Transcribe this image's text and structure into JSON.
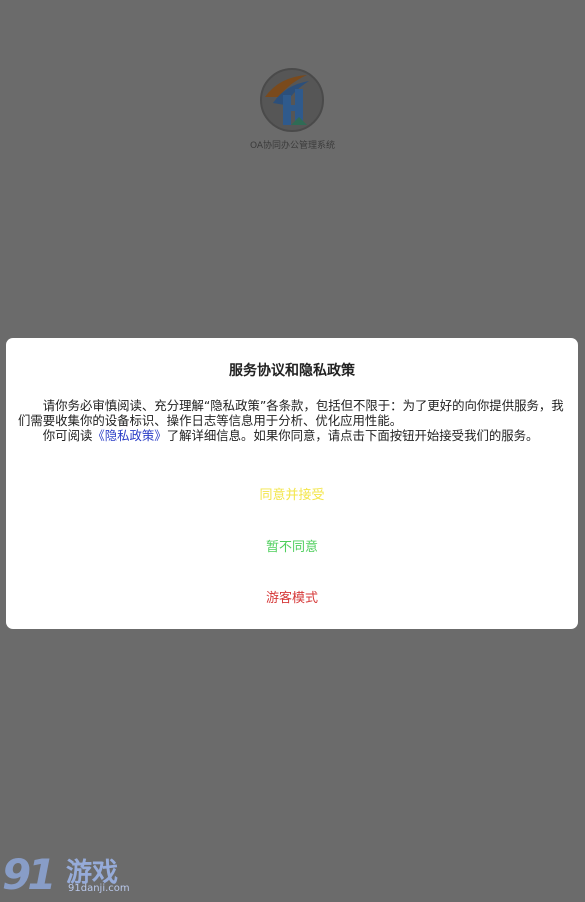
{
  "splash": {
    "caption": "OA协同办公管理系统",
    "logo_icon": "oa-logo-icon"
  },
  "dialog": {
    "title": "服务协议和隐私政策",
    "paragraph1": "请你务必审慎阅读、充分理解“隐私政策”各条款，包括但不限于：为了更好的向你提供服务，我们需要收集你的设备标识、操作日志等信息用于分析、优化应用性能。",
    "paragraph2_prefix": "你可阅读",
    "policy_link": "《隐私政策》",
    "paragraph2_suffix": "了解详细信息。如果你同意，请点击下面按钮开始接受我们的服务。",
    "buttons": {
      "agree": "同意并接受",
      "disagree": "暂不同意",
      "guest": "游客模式"
    }
  },
  "watermark": {
    "mark": "91",
    "name": "游戏",
    "url": "91danji.com"
  },
  "colors": {
    "overlay": "#6b6b6b",
    "agree": "#f3e64a",
    "disagree": "#4fcf5d",
    "guest": "#d63a3a",
    "link": "#2b3ec7"
  }
}
